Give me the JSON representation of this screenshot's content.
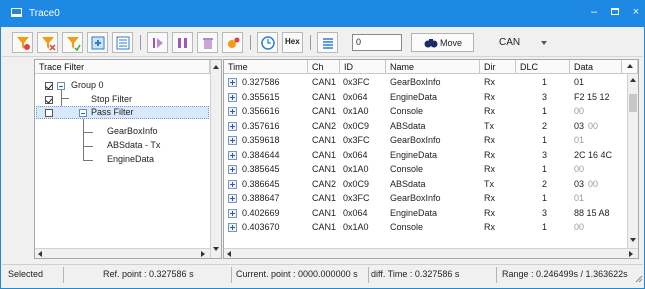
{
  "window": {
    "title": "Trace0"
  },
  "toolbar": {
    "filter_value": "0",
    "move_label": "Move",
    "hex_label": "Hex",
    "protocol_select": "CAN",
    "colors": {
      "orange": "#f39c12",
      "green": "#3aa040",
      "red": "#e04040",
      "purple": "#9b59b6",
      "blue": "#2a7fd4"
    }
  },
  "left_panel": {
    "header": "Trace Filter",
    "items": [
      {
        "label": "Group 0",
        "checked": true,
        "level": 0
      },
      {
        "label": "Stop Filter",
        "checked": true,
        "level": 1
      },
      {
        "label": "Pass Filter",
        "checked": false,
        "level": 1
      },
      {
        "label": "GearBoxInfo",
        "level": 2
      },
      {
        "label": "ABSdata - Tx",
        "level": 2
      },
      {
        "label": "EngineData",
        "level": 2
      }
    ]
  },
  "trace": {
    "columns": [
      "Time",
      "Ch",
      "ID",
      "Name",
      "Dir",
      "DLC",
      "Data"
    ],
    "rows": [
      {
        "time": "0.327586",
        "ch": "CAN1",
        "id": "0x3FC",
        "name": "GearBoxInfo",
        "dir": "Rx",
        "dlc": "1",
        "data": "01",
        "data_faded": ""
      },
      {
        "time": "0.355615",
        "ch": "CAN1",
        "id": "0x064",
        "name": "EngineData",
        "dir": "Rx",
        "dlc": "3",
        "data": "F2  15  12",
        "data_faded": ""
      },
      {
        "time": "0.356616",
        "ch": "CAN1",
        "id": "0x1A0",
        "name": "Console",
        "dir": "Rx",
        "dlc": "1",
        "data": "",
        "data_faded": "00"
      },
      {
        "time": "0.357616",
        "ch": "CAN2",
        "id": "0x0C9",
        "name": "ABSdata",
        "dir": "Tx",
        "dlc": "2",
        "data": "03",
        "data_faded": "00"
      },
      {
        "time": "0.359618",
        "ch": "CAN1",
        "id": "0x3FC",
        "name": "GearBoxInfo",
        "dir": "Rx",
        "dlc": "1",
        "data": "",
        "data_faded": "01"
      },
      {
        "time": "0.384644",
        "ch": "CAN1",
        "id": "0x064",
        "name": "EngineData",
        "dir": "Rx",
        "dlc": "3",
        "data": "2C  16  4C",
        "data_faded": ""
      },
      {
        "time": "0.385645",
        "ch": "CAN1",
        "id": "0x1A0",
        "name": "Console",
        "dir": "Rx",
        "dlc": "1",
        "data": "",
        "data_faded": "00"
      },
      {
        "time": "0.386645",
        "ch": "CAN2",
        "id": "0x0C9",
        "name": "ABSdata",
        "dir": "Tx",
        "dlc": "2",
        "data": "03",
        "data_faded": "00"
      },
      {
        "time": "0.388647",
        "ch": "CAN1",
        "id": "0x3FC",
        "name": "GearBoxInfo",
        "dir": "Rx",
        "dlc": "1",
        "data": "",
        "data_faded": "01"
      },
      {
        "time": "0.402669",
        "ch": "CAN1",
        "id": "0x064",
        "name": "EngineData",
        "dir": "Rx",
        "dlc": "3",
        "data": "88  15  A8",
        "data_faded": ""
      },
      {
        "time": "0.403670",
        "ch": "CAN1",
        "id": "0x1A0",
        "name": "Console",
        "dir": "Rx",
        "dlc": "1",
        "data": "",
        "data_faded": "00"
      }
    ]
  },
  "status": {
    "selected": "Selected",
    "ref_point": "Ref. point : 0.327586 s",
    "current_point": "Current. point : 0000.000000 s",
    "diff_time": "diff. Time : 0.327586 s",
    "range": "Range : 0.246499s / 1.363622s"
  }
}
